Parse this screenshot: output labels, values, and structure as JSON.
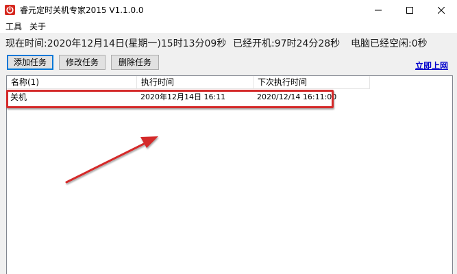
{
  "window": {
    "title": "睿元定时关机专家2015 V1.1.0.0",
    "app_icon": "power-icon",
    "controls": [
      "minimize-icon",
      "maximize-icon",
      "close-icon"
    ]
  },
  "menu": {
    "items": [
      {
        "label": "工具"
      },
      {
        "label": "关于"
      }
    ]
  },
  "status": {
    "now": "现在时间:2020年12月14日(星期一)15时13分09秒",
    "uptime": "已经开机:97时24分28秒",
    "idle": "电脑已经空闲:0秒"
  },
  "toolbar": {
    "add_label": "添加任务",
    "edit_label": "修改任务",
    "delete_label": "删除任务",
    "online_link": "立即上网"
  },
  "task_list": {
    "columns": [
      "名称(1)",
      "执行时间",
      "下次执行时间"
    ],
    "rows": [
      {
        "name": "关机",
        "exec_time": "2020年12月14日 16:11",
        "next_time": "2020/12/14 16:11:00"
      }
    ]
  },
  "colors": {
    "annotation_red": "#d42a2a",
    "link_blue": "#0000cc",
    "app_icon_red": "#d6281f",
    "focus_blue": "#0078d7"
  }
}
